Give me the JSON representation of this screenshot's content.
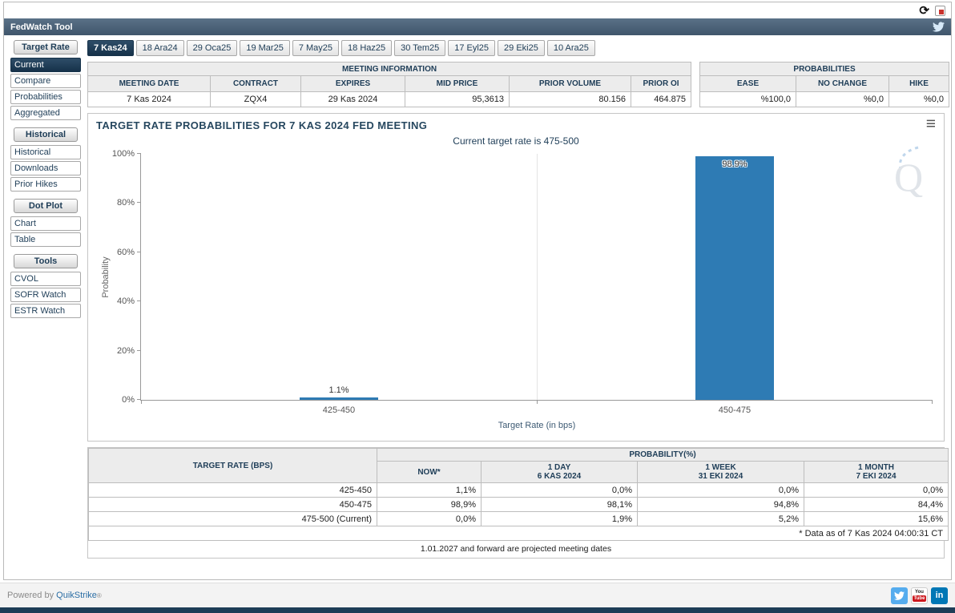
{
  "colors": {
    "accent_navy": "#1e3d57",
    "bar_blue": "#2e7bb4",
    "now_highlight": "#fbfbd7",
    "link_blue": "#2a6da4"
  },
  "icons": {
    "refresh": "⟳",
    "chart_menu": "≡",
    "watermark": "Q",
    "linkedin": "in",
    "youtube_top": "You",
    "youtube_bottom": "Tube"
  },
  "app_bar": {
    "title": "FedWatch Tool"
  },
  "sidebar": {
    "selected_item": "Current",
    "sections": [
      {
        "title": "Target Rate",
        "items": [
          "Current",
          "Compare",
          "Probabilities",
          "Aggregated"
        ]
      },
      {
        "title": "Historical",
        "items": [
          "Historical",
          "Downloads",
          "Prior Hikes"
        ]
      },
      {
        "title": "Dot Plot",
        "items": [
          "Chart",
          "Table"
        ]
      },
      {
        "title": "Tools",
        "items": [
          "CVOL",
          "SOFR Watch",
          "ESTR Watch"
        ]
      }
    ]
  },
  "tabs": {
    "selected": "7 Kas24",
    "items": [
      "7 Kas24",
      "18 Ara24",
      "29 Oca25",
      "19 Mar25",
      "7 May25",
      "18 Haz25",
      "30 Tem25",
      "17 Eyl25",
      "29 Eki25",
      "10 Ara25"
    ]
  },
  "meeting_info": {
    "title": "MEETING INFORMATION",
    "headers": [
      "MEETING DATE",
      "CONTRACT",
      "EXPIRES",
      "MID PRICE",
      "PRIOR VOLUME",
      "PRIOR OI"
    ],
    "values": [
      "7 Kas 2024",
      "ZQX4",
      "29 Kas 2024",
      "95,3613",
      "80.156",
      "464.875"
    ]
  },
  "probabilities_info": {
    "title": "PROBABILITIES",
    "headers": [
      "EASE",
      "NO CHANGE",
      "HIKE"
    ],
    "values": [
      "%100,0",
      "%0,0",
      "%0,0"
    ]
  },
  "chart_data": {
    "type": "bar",
    "title": "TARGET RATE PROBABILITIES FOR 7 KAS 2024 FED MEETING",
    "subtitle": "Current target rate is 475-500",
    "categories": [
      "425-450",
      "450-475"
    ],
    "values": [
      1.1,
      98.9
    ],
    "labels": [
      "1.1%",
      "98.9%"
    ],
    "xlabel": "Target Rate (in bps)",
    "ylabel": "Probability",
    "ylim": [
      0,
      100
    ],
    "yticks": [
      "0%",
      "20%",
      "40%",
      "60%",
      "80%",
      "100%"
    ],
    "grid": "single vertical gridline at center, no horizontal gridlines",
    "legend": "none",
    "bar_color": "#2e7bb4"
  },
  "probability_table": {
    "rate_header": "TARGET RATE (BPS)",
    "group_header": "PROBABILITY(%)",
    "columns": [
      {
        "l1": "NOW*",
        "l2": ""
      },
      {
        "l1": "1 DAY",
        "l2": "6 KAS 2024"
      },
      {
        "l1": "1 WEEK",
        "l2": "31 EKI 2024"
      },
      {
        "l1": "1 MONTH",
        "l2": "7 EKI 2024"
      }
    ],
    "rows": [
      {
        "rate": "425-450",
        "now": "1,1%",
        "day": "0,0%",
        "week": "0,0%",
        "month": "0,0%"
      },
      {
        "rate": "450-475",
        "now": "98,9%",
        "day": "98,1%",
        "week": "94,8%",
        "month": "84,4%"
      },
      {
        "rate": "475-500 (Current)",
        "now": "0,0%",
        "day": "1,9%",
        "week": "5,2%",
        "month": "15,6%"
      }
    ],
    "footnote": "* Data as of 7 Kas 2024 04:00:31 CT",
    "projection_note": "1.01.2027 and forward are projected meeting dates"
  },
  "footer": {
    "powered_by": "Powered by",
    "brand": "QuikStrike",
    "registered": "®"
  }
}
